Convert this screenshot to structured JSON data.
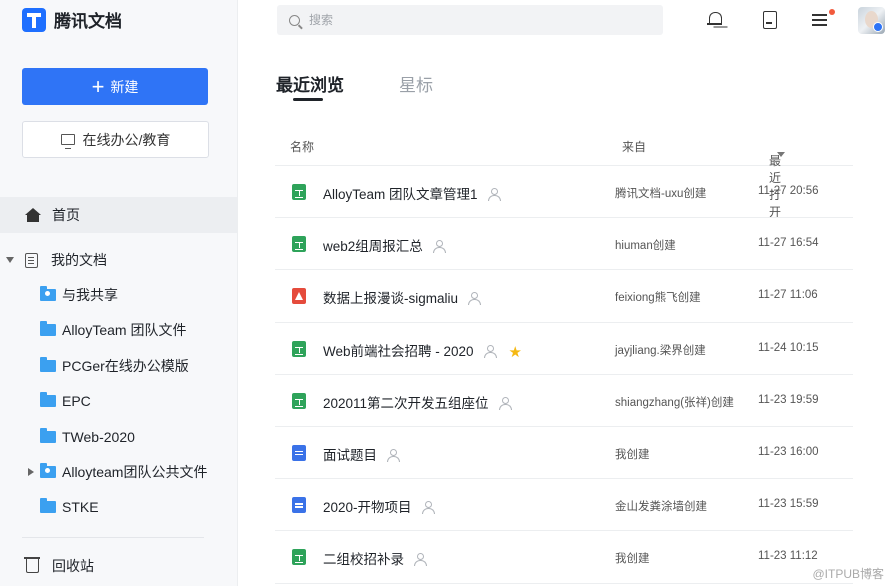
{
  "app": {
    "name": "腾讯文档"
  },
  "sidebar": {
    "new_label": "新建",
    "online_label": "在线办公/教育",
    "home_label": "首页",
    "my_docs_label": "我的文档",
    "folders": [
      {
        "label": "与我共享",
        "shared": true
      },
      {
        "label": "AlloyTeam 团队文件"
      },
      {
        "label": "PCGer在线办公模版"
      },
      {
        "label": "EPC"
      },
      {
        "label": "TWeb-2020"
      },
      {
        "label": "Alloyteam团队公共文件",
        "shared": true,
        "expandable": true
      },
      {
        "label": "STKE"
      }
    ],
    "trash_label": "回收站"
  },
  "search": {
    "placeholder": "搜索"
  },
  "tabs": {
    "recent": "最近浏览",
    "starred": "星标"
  },
  "table": {
    "headers": {
      "name": "名称",
      "source": "来自",
      "opened": "最近打开"
    },
    "rows": [
      {
        "type": "sheet",
        "name": "AlloyTeam 团队文章管理1",
        "source": "腾讯文档-uxu创建",
        "opened": "11-27 20:56",
        "starred": false
      },
      {
        "type": "sheet",
        "name": "web2组周报汇总",
        "source": "hiuman创建",
        "opened": "11-27 16:54",
        "starred": false
      },
      {
        "type": "pdf",
        "name": "数据上报漫谈-sigmaliu",
        "source": "feixiong熊飞创建",
        "opened": "11-27 11:06",
        "starred": false
      },
      {
        "type": "sheet",
        "name": "Web前端社会招聘 - 2020",
        "source": "jayjliang.梁界创建",
        "opened": "11-24 10:15",
        "starred": true
      },
      {
        "type": "sheet",
        "name": "202011第二次开发五组座位",
        "source": "shiangzhang(张祥)创建",
        "opened": "11-23 19:59",
        "starred": false
      },
      {
        "type": "doc",
        "name": "面试题目",
        "source": "我创建",
        "opened": "11-23 16:00",
        "starred": false
      },
      {
        "type": "doc",
        "name": "2020-开物项目",
        "source": "金山发粪涂墙创建",
        "opened": "11-23 15:59",
        "starred": false
      },
      {
        "type": "sheet",
        "name": "二组校招补录",
        "source": "我创建",
        "opened": "11-23 11:12",
        "starred": false
      }
    ]
  },
  "watermark": "@ITPUB博客",
  "colors": {
    "accent": "#2f74f6",
    "sheet": "#2ea35a",
    "doc": "#3a72e8",
    "pdf": "#e54b3c",
    "star": "#f5b813"
  }
}
